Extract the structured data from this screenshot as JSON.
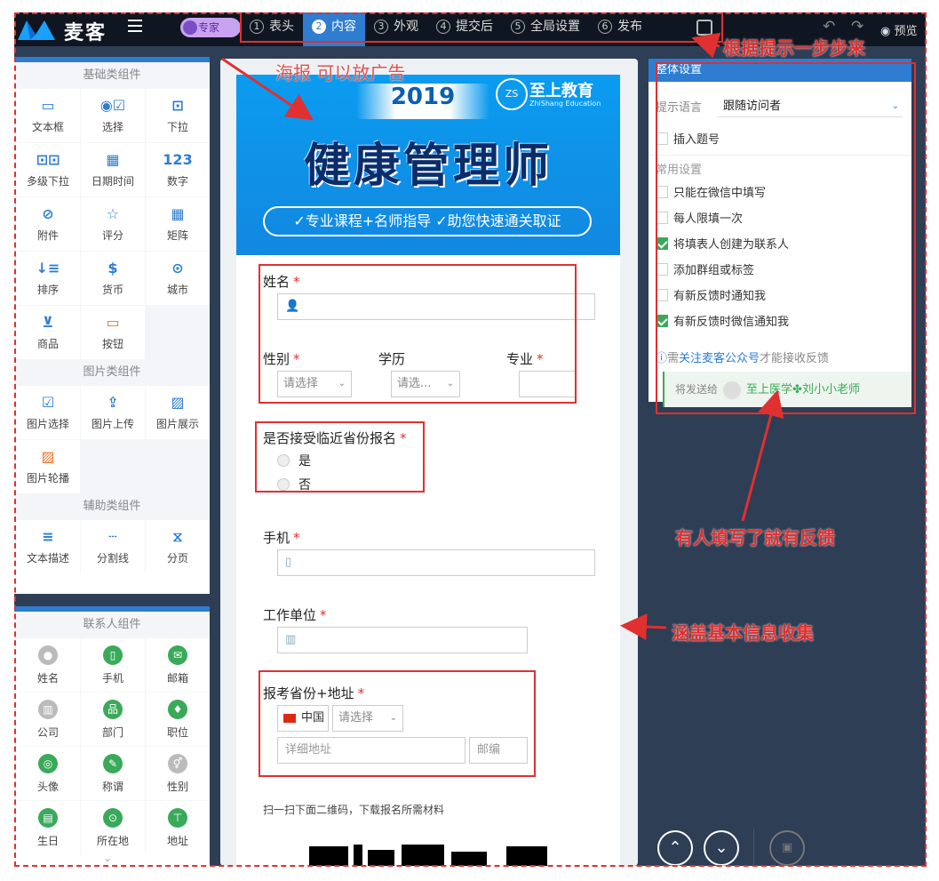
{
  "app": {
    "logo_text": "麦客",
    "expert_badge": "专家",
    "preview_label": "预览"
  },
  "steps": [
    {
      "num": "1",
      "label": "表头"
    },
    {
      "num": "2",
      "label": "内容"
    },
    {
      "num": "3",
      "label": "外观"
    },
    {
      "num": "4",
      "label": "提交后"
    },
    {
      "num": "5",
      "label": "全局设置"
    },
    {
      "num": "6",
      "label": "发布"
    }
  ],
  "palette": {
    "basic_title": "基础类组件",
    "basic": [
      "文本框",
      "选择",
      "下拉",
      "多级下拉",
      "日期时间",
      "数字",
      "附件",
      "评分",
      "矩阵",
      "排序",
      "货币",
      "城市",
      "商品",
      "按钮"
    ],
    "image_title": "图片类组件",
    "image": [
      "图片选择",
      "图片上传",
      "图片展示",
      "图片轮播"
    ],
    "aux_title": "辅助类组件",
    "aux": [
      "文本描述",
      "分割线",
      "分页"
    ],
    "contact_title": "联系人组件",
    "contact": [
      "姓名",
      "手机",
      "邮箱",
      "公司",
      "部门",
      "职位",
      "头像",
      "称谓",
      "性别",
      "生日",
      "所在地",
      "地址"
    ]
  },
  "banner": {
    "year": "2019",
    "brand": "至上教育",
    "brand_sub": "ZhiShang Education",
    "seal": "ZS",
    "title": "健康管理师",
    "slogan": "✓专业课程+名师指导 ✓助您快速通关取证"
  },
  "form": {
    "name_label": "姓名",
    "gender_label": "性别",
    "edu_label": "学历",
    "major_label": "专业",
    "select_placeholder": "请选择",
    "select_placeholder_short": "请选...",
    "province_q": "是否接受临近省份报名",
    "opt_yes": "是",
    "opt_no": "否",
    "phone_label": "手机",
    "work_label": "工作单位",
    "addr_label": "报考省份+地址",
    "country": "中国",
    "addr_placeholder": "详细地址",
    "zip_placeholder": "邮编",
    "qr_note": "扫一扫下面二维码，下载报名所需材料",
    "required_mark": "*"
  },
  "settings": {
    "title": "整体设置",
    "lang_label": "提示语言",
    "lang_value": "跟随访问者",
    "insert_label": "插入题号",
    "common_title": "常用设置",
    "options": [
      {
        "label": "只能在微信中填写",
        "checked": false
      },
      {
        "label": "每人限填一次",
        "checked": false
      },
      {
        "label": "将填表人创建为联系人",
        "checked": true
      },
      {
        "label": "添加群组或标签",
        "checked": false
      },
      {
        "label": "有新反馈时通知我",
        "checked": false
      },
      {
        "label": "有新反馈时微信通知我",
        "checked": true
      }
    ],
    "info_pre": "需",
    "info_link": "关注麦客公众号",
    "info_post": "才能接收反馈",
    "send_label": "将发送给",
    "send_user1": "至上医学",
    "send_user2": "刘小小老师"
  },
  "annotations": {
    "steps": "根据提示一步步来",
    "poster": "海报 可以放广告",
    "feedback": "有人填写了就有反馈",
    "basic": "涵盖基本信息收集"
  },
  "colors": {
    "accent": "#2e7dd1",
    "annot": "#e03030",
    "green": "#3aaa5a"
  }
}
